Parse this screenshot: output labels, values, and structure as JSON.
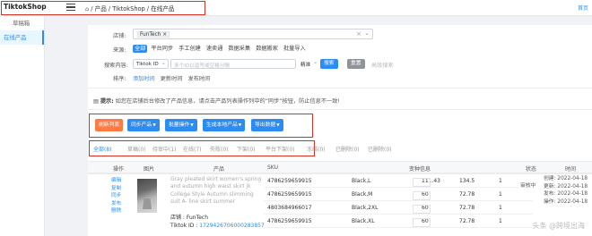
{
  "app": {
    "brand": "TiktokShop"
  },
  "breadcrumb": {
    "home_icon": "home-icon",
    "text": "/ 产品 / TiktokShop / 在线产品",
    "right": "首页"
  },
  "sidebar": {
    "items": [
      {
        "label": "草稿箱"
      },
      {
        "label": "在线产品"
      }
    ]
  },
  "filters": {
    "store_label": "店铺:",
    "store_tag": "FunTech",
    "source_label": "来源:",
    "sources": [
      "全部",
      "平台同步",
      "手工创建",
      "速卖通",
      "数据采集",
      "数据搬家",
      "批量导入"
    ],
    "search_label": "搜索内容:",
    "search_field": "Tiktok ID",
    "search_placeholder": "多个ID以逗号或空格分隔",
    "match_mode": "精准",
    "search_button": "搜索",
    "reset_button": "重置",
    "advanced": "高级搜索",
    "sort_label": "排序:",
    "sorts": [
      "添加时间",
      "更新时间",
      "发布时间"
    ]
  },
  "notice": {
    "prefix": "提示:",
    "text": "如您在店铺后台修改了产品信息，请点击产品列表操作列中的“同步”按钮，防止信息不一致!"
  },
  "actions": {
    "refresh": "刷新列表",
    "sync": "同步产品",
    "bulk": "批量操作",
    "generate": "生成本地产品",
    "export": "导出数据"
  },
  "tabs": [
    "全部(8)",
    "草稿(0)",
    "待审中(1)",
    "在线(7)",
    "失败(0)",
    "下架(0)",
    "平台下架(0)",
    "冻结(0)",
    "已删除(0)",
    "已删除(0)"
  ],
  "table": {
    "headers": {
      "ops": "操作",
      "image": "图片",
      "product": "产品",
      "sku": "SKU",
      "variant_info": "变种信息",
      "spec": "规格",
      "price": "原价(US)",
      "stock": "库存",
      "state": "状态",
      "time": "时间",
      "stock_short": "库存"
    },
    "row": {
      "ops": [
        "编辑",
        "复制",
        "同步",
        "发布",
        "删除"
      ],
      "title": "Gray pleated skirt women's spring and autumn high waist skirt jk College Style Autumn slimming suit A- line skirt summer",
      "store": "店铺 : FunTech",
      "tiktok_id_label": "Tiktok ID : ",
      "tiktok_id": "1729426706000283857",
      "skus": [
        {
          "sku": "4786259659915",
          "spec": "Black,L",
          "price": "111.43",
          "stock": "134.5",
          "qty": "1"
        },
        {
          "sku": "4786259659915",
          "spec": "Black,M",
          "price": "60",
          "stock": "72.78",
          "qty": "1"
        },
        {
          "sku": "4803684966017",
          "spec": "Black,2XL",
          "price": "60",
          "stock": "72.78",
          "qty": "1"
        },
        {
          "sku": "4786259659915",
          "spec": "Black,XL",
          "price": "60",
          "stock": "72.78",
          "qty": "1"
        }
      ],
      "state": "审核中",
      "times": [
        "创建: 2022-04-18",
        "更新: 2022-04-18",
        "发布: 2022-04-18",
        "操作: 2022-04-18"
      ]
    }
  },
  "watermark": "头条 @跨境出海"
}
